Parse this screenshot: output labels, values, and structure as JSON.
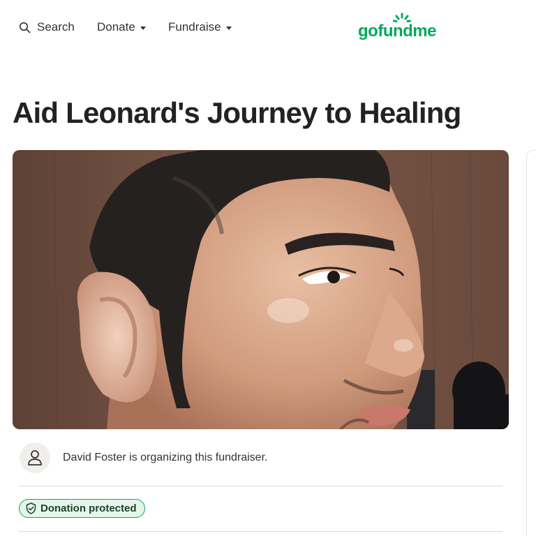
{
  "nav": {
    "search_label": "Search",
    "donate_label": "Donate",
    "fundraise_label": "Fundraise",
    "logo_text": "gofundme",
    "brand_color": "#02a95c"
  },
  "campaign": {
    "title": "Aid Leonard's Journey to Healing",
    "organizer_text": "David Foster is organizing this fundraiser.",
    "badge_label": "Donation protected"
  },
  "icons": [
    "search-icon",
    "chevron-down-icon",
    "user-icon",
    "shield-icon"
  ]
}
